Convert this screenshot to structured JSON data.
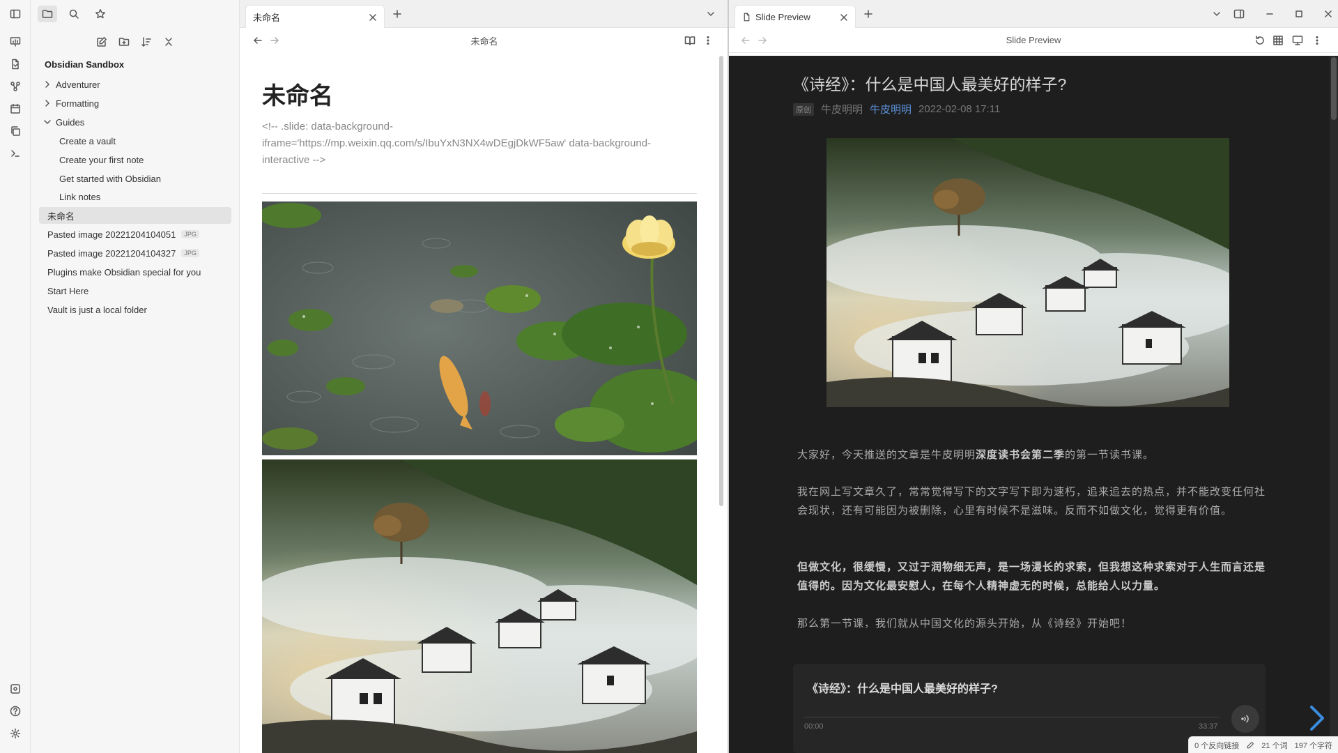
{
  "ribbon": {
    "top_icons": [
      "slide-icon",
      "file-icon",
      "graph-icon",
      "calendar-icon",
      "copy-icon",
      "terminal-icon"
    ],
    "bottom_icons": [
      "vault-switch-icon",
      "help-icon",
      "settings-icon"
    ]
  },
  "sidebar": {
    "vault_name": "Obsidian Sandbox",
    "folders": [
      {
        "label": "Adventurer",
        "expanded": false
      },
      {
        "label": "Formatting",
        "expanded": false
      },
      {
        "label": "Guides",
        "expanded": true
      }
    ],
    "guides_children": [
      "Create a vault",
      "Create your first note",
      "Get started with Obsidian",
      "Link notes"
    ],
    "files": [
      {
        "label": "未命名",
        "badge": "",
        "active": true
      },
      {
        "label": "Pasted image 20221204104051",
        "badge": "JPG"
      },
      {
        "label": "Pasted image 20221204104327",
        "badge": "JPG"
      },
      {
        "label": "Plugins make Obsidian special for you",
        "badge": ""
      },
      {
        "label": "Start Here",
        "badge": ""
      },
      {
        "label": "Vault is just a local folder",
        "badge": ""
      }
    ]
  },
  "editor": {
    "tab_label": "未命名",
    "view_title": "未命名",
    "doc_title": "未命名",
    "comment": "<!-- .slide: data-background-iframe='https://mp.weixin.qq.com/s/IbuYxN3NX4wDEgjDkWF5aw' data-background-interactive -->"
  },
  "preview": {
    "tab_label": "Slide Preview",
    "view_title": "Slide Preview",
    "article_title": "《诗经》：什么是中国人最美好的样子?",
    "meta_original": "原创",
    "meta_author": "牛皮明明",
    "meta_account": "牛皮明明",
    "meta_date": "2022-02-08 17:11",
    "p1_a": "大家好，今天推送的文章是牛皮明明",
    "p1_b": "深度读书会第二季",
    "p1_c": "的第一节读书课。",
    "p2": "我在网上写文章久了，常常觉得写下的文字写下即为速朽，追来追去的热点，并不能改变任何社会现状，还有可能因为被删除，心里有时候不是滋味。反而不如做文化，觉得更有价值。",
    "p3": "但做文化，很缓慢，又过于润物细无声，是一场漫长的求索，但我想这种求索对于人生而言还是值得的。因为文化最安慰人，在每个人精神虚无的时候，总能给人以力量。",
    "p4": "那么第一节课，我们就从中国文化的源头开始，从《诗经》开始吧！",
    "audio_title": "《诗经》：什么是中国人最美好的样子?",
    "audio_start": "00:00",
    "audio_end": "33:37"
  },
  "status": {
    "backlinks": "0 个反向链接",
    "words": "21 个词",
    "chars": "197 个字符"
  }
}
